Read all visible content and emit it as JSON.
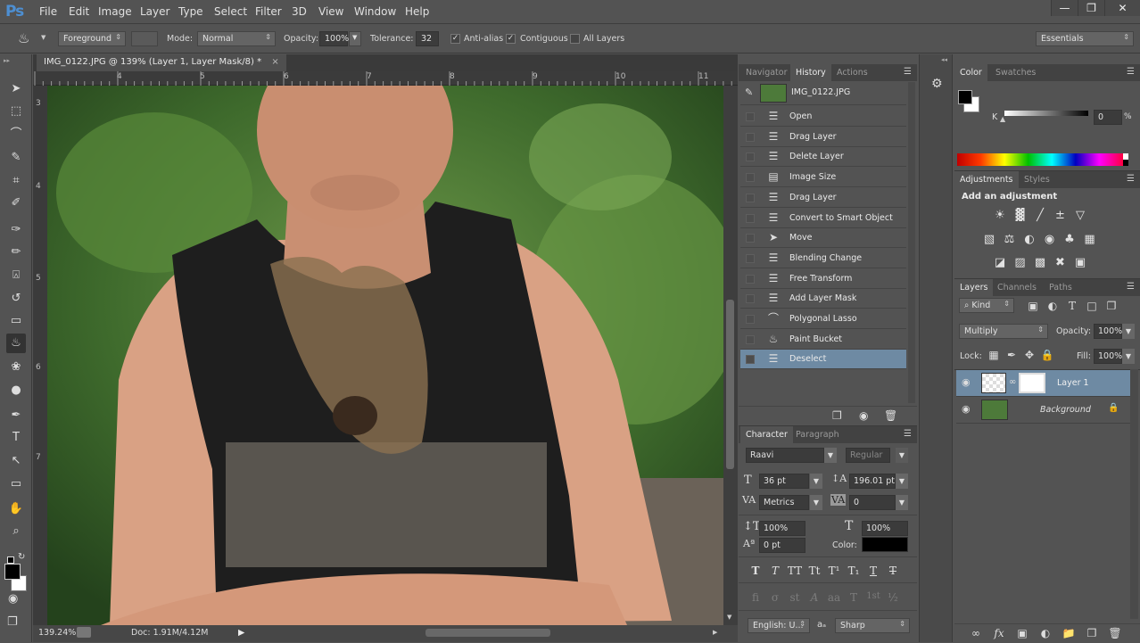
{
  "app": {
    "logo": "Ps",
    "menu": [
      "File",
      "Edit",
      "Image",
      "Layer",
      "Type",
      "Select",
      "Filter",
      "3D",
      "View",
      "Window",
      "Help"
    ],
    "window_controls": {
      "minimize": "—",
      "restore": "❐",
      "close": "✕"
    }
  },
  "options_bar": {
    "tool_icon": "paint-bucket-icon",
    "fill_source": "Foreground",
    "mode_label": "Mode:",
    "mode_value": "Normal",
    "opacity_label": "Opacity:",
    "opacity_value": "100%",
    "tolerance_label": "Tolerance:",
    "tolerance_value": "32",
    "anti_alias_label": "Anti-alias",
    "anti_alias_checked": true,
    "contiguous_label": "Contiguous",
    "contiguous_checked": true,
    "all_layers_label": "All Layers",
    "all_layers_checked": false,
    "workspace": "Essentials"
  },
  "document": {
    "tab_title": "IMG_0122.JPG @ 139% (Layer 1, Layer Mask/8) *",
    "close_glyph": "×",
    "ruler_top": [
      "4",
      "5",
      "6",
      "7",
      "8",
      "9",
      "10",
      "11"
    ],
    "ruler_left": [
      "3",
      "4",
      "5",
      "6",
      "7"
    ],
    "zoom_level": "139.24%",
    "doc_size": "Doc: 1.91M/4.12M"
  },
  "tools": [
    {
      "name": "move-tool",
      "glyph": "➤"
    },
    {
      "name": "marquee-tool",
      "glyph": "⬚"
    },
    {
      "name": "lasso-tool",
      "glyph": "⌒"
    },
    {
      "name": "quick-selection-tool",
      "glyph": "✎"
    },
    {
      "name": "crop-tool",
      "glyph": "⌗"
    },
    {
      "name": "eyedropper-tool",
      "glyph": "✐"
    },
    {
      "name": "healing-brush-tool",
      "glyph": "✑"
    },
    {
      "name": "brush-tool",
      "glyph": "✏"
    },
    {
      "name": "clone-stamp-tool",
      "glyph": "⍓"
    },
    {
      "name": "history-brush-tool",
      "glyph": "↺"
    },
    {
      "name": "eraser-tool",
      "glyph": "▭"
    },
    {
      "name": "paint-bucket-tool",
      "glyph": "♨",
      "active": true
    },
    {
      "name": "blur-tool",
      "glyph": "❀"
    },
    {
      "name": "dodge-tool",
      "glyph": "●"
    },
    {
      "name": "pen-tool",
      "glyph": "✒"
    },
    {
      "name": "type-tool",
      "glyph": "T"
    },
    {
      "name": "path-selection-tool",
      "glyph": "↖"
    },
    {
      "name": "rectangle-tool",
      "glyph": "▭"
    },
    {
      "name": "hand-tool",
      "glyph": "✋"
    },
    {
      "name": "zoom-tool",
      "glyph": "⌕"
    }
  ],
  "colors": {
    "foreground": "#000000",
    "background": "#ffffff",
    "selection_highlight": "#6e8aa3",
    "panel_bg": "#535353"
  },
  "history_panel": {
    "tabs": [
      "Navigator",
      "History",
      "Actions"
    ],
    "active_tab": "History",
    "snapshot": "IMG_0122.JPG",
    "items": [
      {
        "label": "Open",
        "icon": "document-icon"
      },
      {
        "label": "Drag Layer",
        "icon": "document-icon"
      },
      {
        "label": "Delete Layer",
        "icon": "document-icon"
      },
      {
        "label": "Image Size",
        "icon": "image-size-icon"
      },
      {
        "label": "Drag Layer",
        "icon": "document-icon"
      },
      {
        "label": "Convert to Smart Object",
        "icon": "document-icon"
      },
      {
        "label": "Move",
        "icon": "move-icon"
      },
      {
        "label": "Blending Change",
        "icon": "document-icon"
      },
      {
        "label": "Free Transform",
        "icon": "document-icon"
      },
      {
        "label": "Add Layer Mask",
        "icon": "document-icon"
      },
      {
        "label": "Polygonal Lasso",
        "icon": "lasso-icon"
      },
      {
        "label": "Paint Bucket",
        "icon": "paint-bucket-icon"
      },
      {
        "label": "Deselect",
        "icon": "document-icon",
        "selected": true
      }
    ]
  },
  "character_panel": {
    "tabs": [
      "Character",
      "Paragraph"
    ],
    "active_tab": "Character",
    "font_family": "Raavi",
    "font_style": "Regular",
    "font_size": "36 pt",
    "leading": "196.01 pt",
    "kerning": "Metrics",
    "tracking": "0",
    "vertical_scale": "100%",
    "horizontal_scale": "100%",
    "baseline_shift": "0 pt",
    "color_label": "Color:",
    "color_value": "#000000",
    "style_buttons": [
      "T",
      "T",
      "TT",
      "Tt",
      "T¹",
      "T₁",
      "T",
      "T"
    ],
    "opentype_buttons": [
      "fi",
      "σ",
      "st",
      "A",
      "aa",
      "T",
      "1st",
      "½"
    ],
    "language": "English: U...",
    "aa_label": "aₐ",
    "antialias_method": "Sharp"
  },
  "color_panel": {
    "tabs": [
      "Color",
      "Swatches"
    ],
    "active_tab": "Color",
    "channel_label": "K",
    "channel_value": "0",
    "unit": "%"
  },
  "adjustments_panel": {
    "tabs": [
      "Adjustments",
      "Styles"
    ],
    "active_tab": "Adjustments",
    "heading": "Add an adjustment",
    "rows": [
      [
        "brightness-contrast",
        "levels",
        "curves",
        "exposure",
        "vibrance"
      ],
      [
        "hue-saturation",
        "color-balance",
        "black-white",
        "photo-filter",
        "channel-mixer",
        "color-lookup"
      ],
      [
        "invert",
        "posterize",
        "threshold",
        "selective-color",
        "gradient-map"
      ]
    ]
  },
  "layers_panel": {
    "tabs": [
      "Layers",
      "Channels",
      "Paths"
    ],
    "active_tab": "Layers",
    "filter_kind": "Kind",
    "blend_mode": "Multiply",
    "opacity_label": "Opacity:",
    "opacity_value": "100%",
    "lock_label": "Lock:",
    "fill_label": "Fill:",
    "fill_value": "100%",
    "layers": [
      {
        "name": "Layer 1",
        "visible": true,
        "selected": true,
        "has_mask": true
      },
      {
        "name": "Background",
        "visible": true,
        "selected": false,
        "locked": true
      }
    ]
  }
}
